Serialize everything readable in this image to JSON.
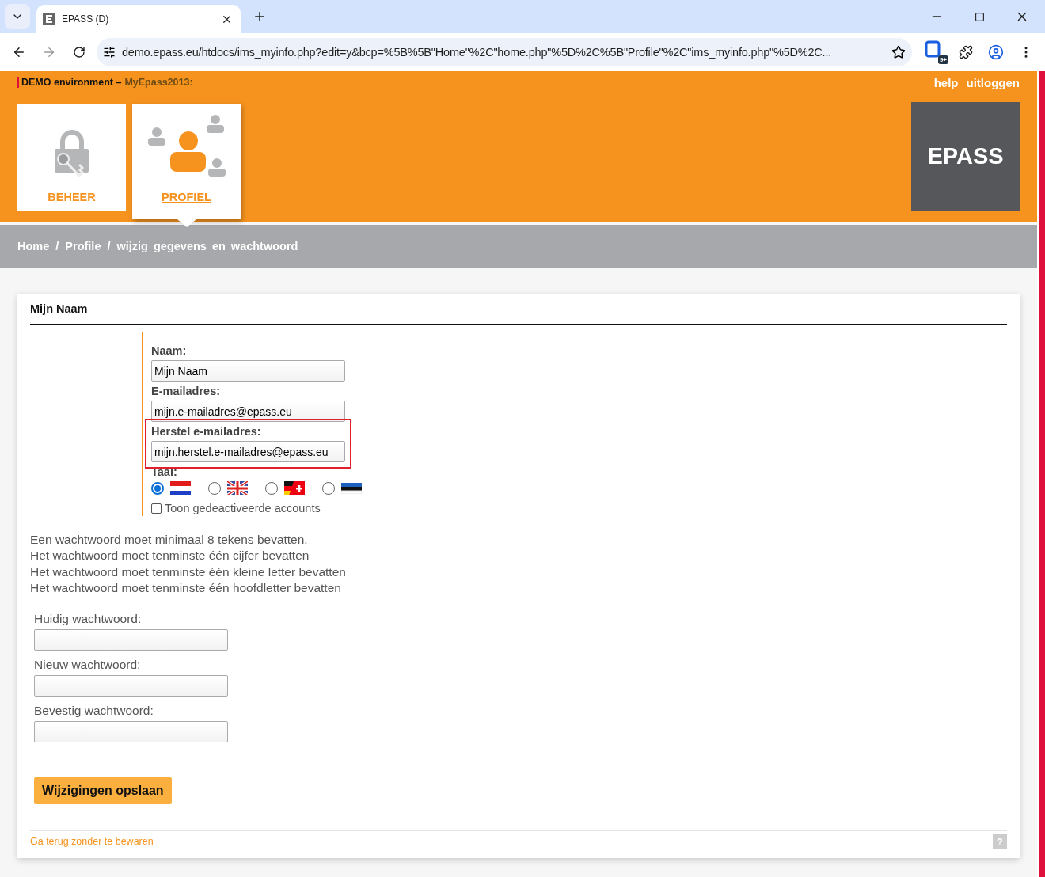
{
  "browser": {
    "tab_title": "EPASS (D)",
    "url": "demo.epass.eu/htdocs/ims_myinfo.php?edit=y&bcp=%5B%5B\"Home\"%2C\"home.php\"%5D%2C%5B\"Profile\"%2C\"ims_myinfo.php\"%5D%2C...",
    "badge": "9+"
  },
  "header": {
    "environment": "DEMO environment –",
    "account": "MyEpass2013:",
    "links": [
      "help",
      "uitloggen"
    ],
    "tiles": [
      {
        "label": "BEHEER",
        "kind": "lock",
        "selected": false
      },
      {
        "label": "PROFIEL",
        "kind": "people",
        "selected": true
      }
    ],
    "logo": "EPASS"
  },
  "breadcrumb": {
    "items": [
      "Home",
      "Profile",
      "wijzig gegevens en wachtwoord"
    ],
    "separator": "/"
  },
  "card": {
    "title": "Mijn Naam",
    "fields": [
      {
        "label": "Naam:",
        "value": "Mijn Naam",
        "highlighted": false
      },
      {
        "label": "E-mailadres:",
        "value": "mijn.e-mailadres@epass.eu",
        "highlighted": false
      },
      {
        "label": "Herstel e-mailadres:",
        "value": "mijn.herstel.e-mailadres@epass.eu",
        "highlighted": true
      }
    ],
    "language_label": "Taal:",
    "languages": [
      {
        "kind": "nl",
        "selected": true
      },
      {
        "kind": "en",
        "selected": false
      },
      {
        "kind": "de-ch",
        "selected": false
      },
      {
        "kind": "ee",
        "selected": false
      }
    ],
    "checkbox": {
      "label": "Toon gedeactiveerde accounts",
      "checked": false
    },
    "rules": [
      "Een wachtwoord moet minimaal 8 tekens bevatten.",
      "Het wachtwoord moet tenminste één cijfer bevatten",
      "Het wachtwoord moet tenminste één kleine letter bevatten",
      "Het wachtwoord moet tenminste één hoofdletter bevatten"
    ],
    "password_fields": [
      {
        "label": "Huidig wachtwoord:"
      },
      {
        "label": "Nieuw wachtwoord:"
      },
      {
        "label": "Bevestig wachtwoord:"
      }
    ],
    "save_button": "Wijzigingen opslaan",
    "back_link": "Ga terug zonder te bewaren",
    "help": "?"
  }
}
